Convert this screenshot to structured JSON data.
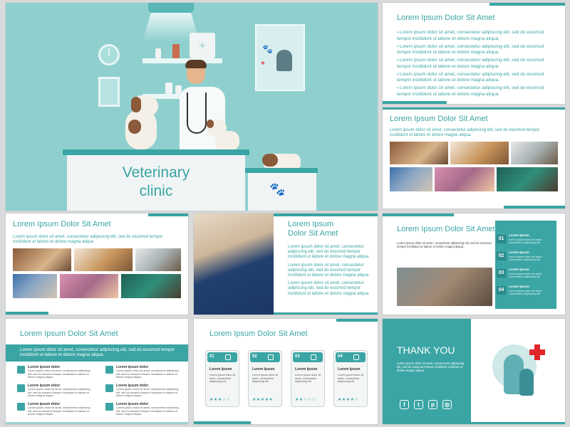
{
  "slide1": {
    "title_line1": "Veterinary",
    "title_line2": "clinic"
  },
  "slide2": {
    "title": "Lorem Ipsum Dolor Sit Amet",
    "bullets": [
      "Lorem ipsum dolor sit amet, consectetur adipiscing elit, sed do eiusmod tempor incididunt ut labore et dolore magna aliqua.",
      "Lorem ipsum dolor sit amet, consectetur adipiscing elit, sed do eiusmod tempor incididunt ut labore et dolore magna aliqua.",
      "Lorem ipsum dolor sit amet, consectetur adipiscing elit, sed do eiusmod tempor incididunt ut labore et dolore magna aliqua.",
      "Lorem ipsum dolor sit amet, consectetur adipiscing elit, sed do eiusmod tempor incididunt ut labore et dolore magna aliqua.",
      "Lorem ipsum dolor sit amet, consectetur adipiscing elit, sed do eiusmod tempor incididunt ut labore et dolore magna aliqua."
    ]
  },
  "slide3": {
    "title": "Lorem Ipsum Dolor Sit Amet",
    "text": "Lorem ipsum dolor sit amet, consectetur adipiscing elit, sed do eiusmod tempor incididunt ut labore et dolore magna aliqua."
  },
  "slide4": {
    "title": "Lorem Ipsum Dolor Sit Amet",
    "text": "Lorem ipsum dolor sit amet, consectetur adipiscing elit, sed do eiusmod tempor incididunt ut labore et dolore magna aliqua."
  },
  "slide5": {
    "title_line1": "Lorem Ipsum",
    "title_line2": "Dolor Sit Amet",
    "paragraphs": [
      "Lorem ipsum dolor sit amet, consectetur adipiscing elit, sed do eiusmod tempor incididunt ut labore et dolore magna aliqua.",
      "Lorem ipsum dolor sit amet, consectetur adipiscing elit, sed do eiusmod tempor incididunt ut labore et dolore magna aliqua.",
      "Lorem ipsum dolor sit amet, consectetur adipiscing elit, sed do eiusmod tempor incididunt ut labore et dolore magna aliqua."
    ]
  },
  "slide6": {
    "title": "Lorem Ipsum Dolor Sit Amet",
    "text": "Lorem ipsum dolor sit amet, consectetur adipiscing elit, sed do eiusmod tempor incididunt ut labore et dolore magna aliqua.",
    "items": [
      {
        "num": "01",
        "head": "Lorem Ipsum",
        "body": "Lorem ipsum dolor sit amet, consectetur adipiscing elit."
      },
      {
        "num": "02",
        "head": "Lorem Ipsum",
        "body": "Lorem ipsum dolor sit amet, consectetur adipiscing elit."
      },
      {
        "num": "03",
        "head": "Lorem Ipsum",
        "body": "Lorem ipsum dolor sit amet, consectetur adipiscing elit."
      },
      {
        "num": "04",
        "head": "Lorem Ipsum",
        "body": "Lorem ipsum dolor sit amet, consectetur adipiscing elit."
      }
    ]
  },
  "slide7": {
    "title": "Lorem Ipsum Dolor Sit Amet",
    "banner": "Lorem ipsum dolor sit amet, consectetur adipiscing elit, sed do eiusmod tempor incididunt ut labore et dolore magna aliqua.",
    "item_head": "Lorem ipsum dolor",
    "item_body": "Lorem ipsum dolor sit amet, consectetur adipiscing elit, sed do eiusmod tempor incididunt ut labore et dolore magna aliqua."
  },
  "slide8": {
    "title": "Lorem Ipsum Dolor Sit Amet",
    "cards": [
      {
        "num": "01",
        "head": "Lorem Ipsum",
        "body": "Lorem ipsum dolor sit amet, consectetur adipiscing elit.",
        "rating": "★★★☆☆"
      },
      {
        "num": "02",
        "head": "Lorem Ipsum",
        "body": "Lorem ipsum dolor sit amet, consectetur adipiscing elit.",
        "rating": "★★★★★"
      },
      {
        "num": "03",
        "head": "Lorem Ipsum",
        "body": "Lorem ipsum dolor sit amet, consectetur adipiscing elit.",
        "rating": "★★☆☆☆"
      },
      {
        "num": "04",
        "head": "Lorem Ipsum",
        "body": "Lorem ipsum dolor sit amet, consectetur adipiscing elit.",
        "rating": "★★★★☆"
      }
    ]
  },
  "slide9": {
    "title": "THANK YOU",
    "text": "Lorem ipsum dolor sit amet, consectetur adipiscing elit, sed do eiusmod tempor incididunt ut labore et dolore magna aliqua.",
    "social_icons": [
      "facebook-icon",
      "twitter-icon",
      "pinterest-icon",
      "instagram-icon"
    ]
  },
  "colors": {
    "accent": "#3aa5a4",
    "accent_dark": "#2a8a89",
    "cover_bg": "#8fd0cf",
    "cross": "#e0262b"
  }
}
